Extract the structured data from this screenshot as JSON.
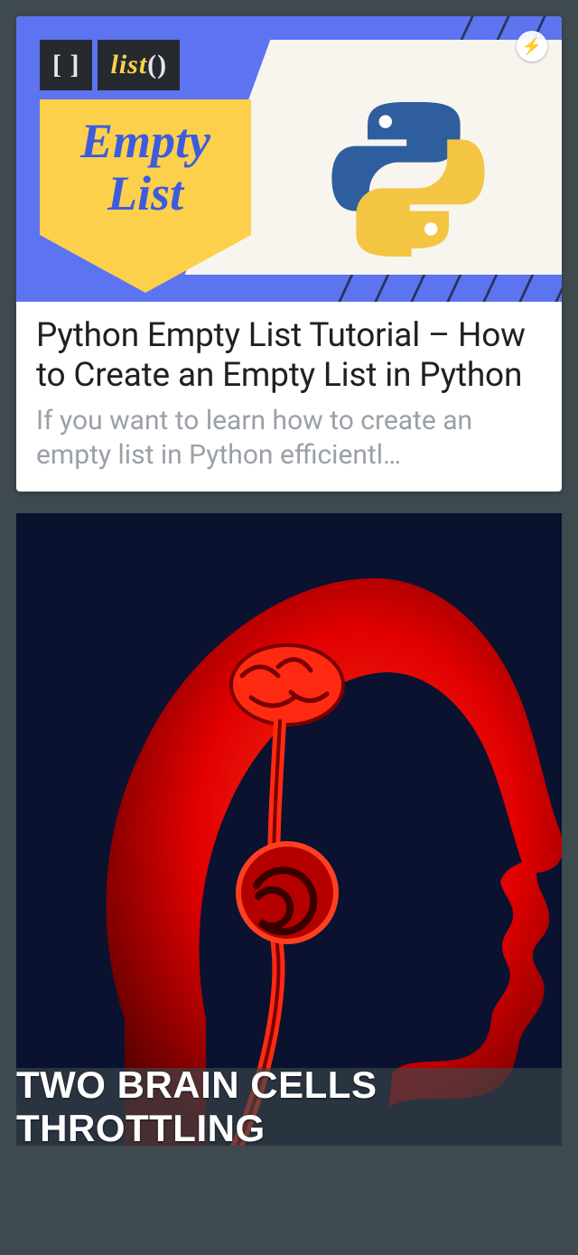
{
  "card": {
    "cover": {
      "code_brackets": "[  ]",
      "code_func": "list",
      "code_parens": "()",
      "banner_top": "Empty",
      "banner_bottom": "List",
      "python_logo_name": "python-logo",
      "amp_badge_glyph": "⚡"
    },
    "title": "Python Empty List Tutorial – How to Create an Empty List in Python",
    "description": "If you want to learn how to create an empty list in Python efficientl…"
  },
  "meme": {
    "caption": "TWO BRAIN CELLS THROTTLING"
  },
  "colors": {
    "page_bg": "#3f4a4f",
    "card_bg": "#ffffff",
    "cover_bg": "#5c74f0",
    "banner_bg": "#fcd04b",
    "banner_text": "#3e5bdd",
    "desc_text": "#9aa0a6",
    "meme_bg": "#0a1230",
    "meme_red": "#ff1a1a"
  }
}
